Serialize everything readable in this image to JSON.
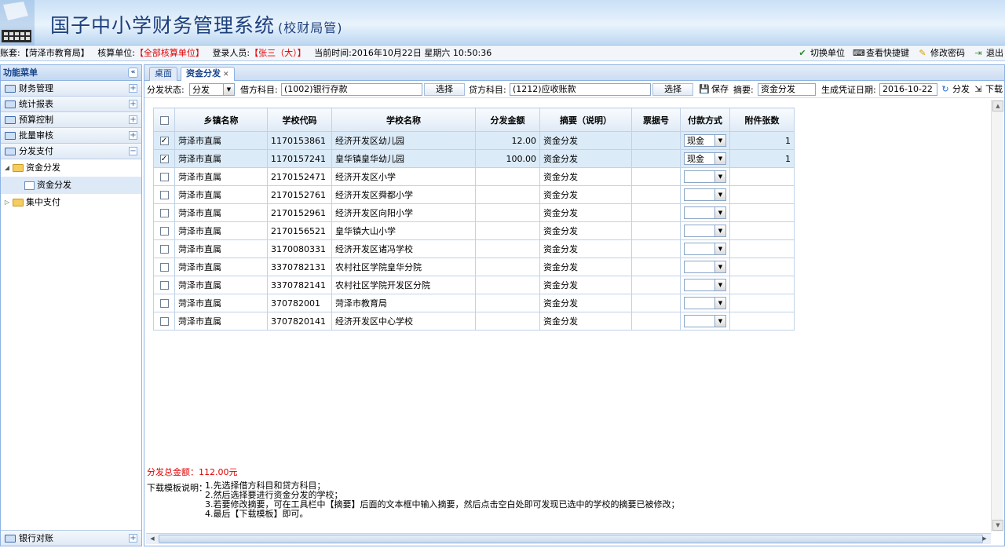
{
  "header": {
    "title": "国子中小学财务管理系统",
    "subtitle": "(校财局管)"
  },
  "infobar": {
    "account_label": "账套:",
    "account_value": "【菏泽市教育局】",
    "unit_label": "核算单位:",
    "unit_value": "【全部核算单位】",
    "user_label": "登录人员:",
    "user_value": "【张三（大）】",
    "time_label": "当前时间:",
    "time_value": "2016年10月22日 星期六 10:50:36",
    "links": [
      "切换单位",
      "查看快捷键",
      "修改密码",
      "退出"
    ]
  },
  "sidebar": {
    "title": "功能菜单",
    "menus": [
      "财务管理",
      "统计报表",
      "预算控制",
      "批量审核",
      "分发支付"
    ],
    "tree": {
      "folder1": "资金分发",
      "leaf1": "资金分发",
      "folder2": "集中支付"
    },
    "bottom_menu": "银行对账"
  },
  "tabs": [
    "桌面",
    "资金分发"
  ],
  "toolbar": {
    "status_label": "分发状态:",
    "status_value": "分发",
    "debit_label": "借方科目:",
    "debit_value": "(1002)银行存款",
    "select_label": "选择",
    "credit_label": "贷方科目:",
    "credit_value": "(1212)应收账款",
    "save_label": "保存",
    "summary_label": "摘要:",
    "summary_value": "资金分发",
    "date_label": "生成凭证日期:",
    "date_value": "2016-10-22",
    "distribute_label": "分发",
    "download_label": "下载"
  },
  "grid": {
    "columns": [
      "乡镇名称",
      "学校代码",
      "学校名称",
      "分发金额",
      "摘要（说明）",
      "票据号",
      "付款方式",
      "附件张数"
    ],
    "rows": [
      {
        "checked": true,
        "town": "菏泽市直属",
        "code": "1170153861",
        "school": "经济开发区幼儿园",
        "amount": "12.00",
        "summary": "资金分发",
        "bill": "",
        "pay": "现金",
        "att": "1"
      },
      {
        "checked": true,
        "town": "菏泽市直属",
        "code": "1170157241",
        "school": "皇华镇皇华幼儿园",
        "amount": "100.00",
        "summary": "资金分发",
        "bill": "",
        "pay": "现金",
        "att": "1"
      },
      {
        "checked": false,
        "town": "菏泽市直属",
        "code": "2170152471",
        "school": "经济开发区小学",
        "amount": "",
        "summary": "资金分发",
        "bill": "",
        "pay": "",
        "att": ""
      },
      {
        "checked": false,
        "town": "菏泽市直属",
        "code": "2170152761",
        "school": "经济开发区舜都小学",
        "amount": "",
        "summary": "资金分发",
        "bill": "",
        "pay": "",
        "att": ""
      },
      {
        "checked": false,
        "town": "菏泽市直属",
        "code": "2170152961",
        "school": "经济开发区向阳小学",
        "amount": "",
        "summary": "资金分发",
        "bill": "",
        "pay": "",
        "att": ""
      },
      {
        "checked": false,
        "town": "菏泽市直属",
        "code": "2170156521",
        "school": "皇华镇大山小学",
        "amount": "",
        "summary": "资金分发",
        "bill": "",
        "pay": "",
        "att": ""
      },
      {
        "checked": false,
        "town": "菏泽市直属",
        "code": "3170080331",
        "school": "经济开发区诸冯学校",
        "amount": "",
        "summary": "资金分发",
        "bill": "",
        "pay": "",
        "att": ""
      },
      {
        "checked": false,
        "town": "菏泽市直属",
        "code": "3370782131",
        "school": "农村社区学院皇华分院",
        "amount": "",
        "summary": "资金分发",
        "bill": "",
        "pay": "",
        "att": ""
      },
      {
        "checked": false,
        "town": "菏泽市直属",
        "code": "3370782141",
        "school": "农村社区学院开发区分院",
        "amount": "",
        "summary": "资金分发",
        "bill": "",
        "pay": "",
        "att": ""
      },
      {
        "checked": false,
        "town": "菏泽市直属",
        "code": "370782001",
        "school": "菏泽市教育局",
        "amount": "",
        "summary": "资金分发",
        "bill": "",
        "pay": "",
        "att": ""
      },
      {
        "checked": false,
        "town": "菏泽市直属",
        "code": "3707820141",
        "school": "经济开发区中心学校",
        "amount": "",
        "summary": "资金分发",
        "bill": "",
        "pay": "",
        "att": ""
      }
    ]
  },
  "footer": {
    "total": "分发总金额：112.00元",
    "template_label": "下载模板说明：",
    "template_lines": [
      "1.先选择借方科目和贷方科目；",
      "2.然后选择要进行资金分发的学校；",
      "3.若要修改摘要，可在工具栏中【摘要】后面的文本框中输入摘要，然后点击空白处即可发现已选中的学校的摘要已被修改；",
      "4.最后【下载模板】即可。"
    ]
  },
  "colors": {
    "accent": "#15428b",
    "highlight": "#e00000",
    "selected_row": "#dcebf8"
  }
}
